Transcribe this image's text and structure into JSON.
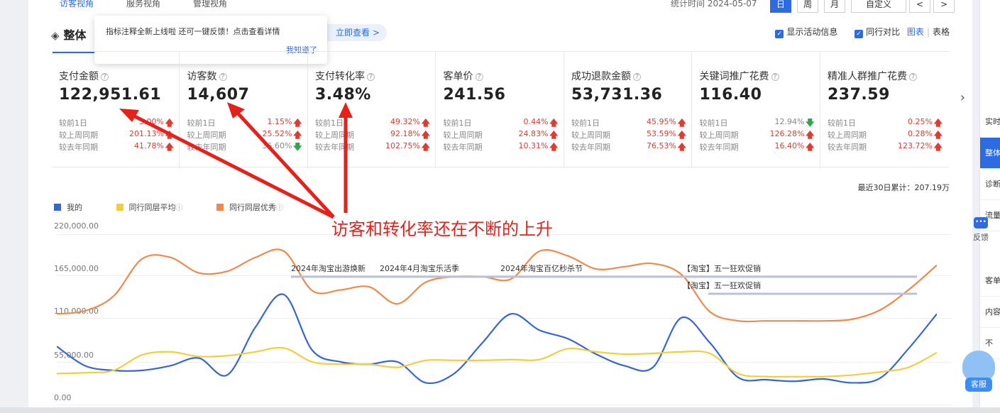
{
  "top_nav": {
    "tabs": [
      "访客视角",
      "服务视角",
      "管理视角"
    ],
    "stat_time": "统计时间 2024-05-07",
    "periods": [
      "日",
      "周",
      "月",
      "自定义"
    ],
    "prev_label": "<",
    "next_label": ">"
  },
  "section": {
    "title": "整体",
    "banner_link": "立即查看 >",
    "popup_text": "指标注释全新上线啦 还可一键反馈！点击查看详情",
    "popup_ok": "我知道了",
    "opt_activity": "显示活动信息",
    "opt_peer": "同行对比",
    "view_chart": "图表",
    "view_sep": "|",
    "view_table": "表格"
  },
  "compare_labels": [
    "较前1日",
    "较上周同期",
    "较去年同期"
  ],
  "metrics": [
    {
      "label": "支付金额",
      "value": "122,951.61",
      "changes": [
        {
          "pct": "5.00%",
          "dir": "up"
        },
        {
          "pct": "201.13%",
          "dir": "up"
        },
        {
          "pct": "41.78%",
          "dir": "up"
        }
      ]
    },
    {
      "label": "访客数",
      "value": "14,607",
      "changes": [
        {
          "pct": "1.15%",
          "dir": "up"
        },
        {
          "pct": "25.52%",
          "dir": "up"
        },
        {
          "pct": "36.60%",
          "dir": "down"
        }
      ]
    },
    {
      "label": "支付转化率",
      "value": "3.48%",
      "changes": [
        {
          "pct": "49.32%",
          "dir": "up"
        },
        {
          "pct": "92.18%",
          "dir": "up"
        },
        {
          "pct": "102.75%",
          "dir": "up"
        }
      ]
    },
    {
      "label": "客单价",
      "value": "241.56",
      "changes": [
        {
          "pct": "0.44%",
          "dir": "up"
        },
        {
          "pct": "24.83%",
          "dir": "up"
        },
        {
          "pct": "10.31%",
          "dir": "up"
        }
      ]
    },
    {
      "label": "成功退款金额",
      "value": "53,731.36",
      "changes": [
        {
          "pct": "45.95%",
          "dir": "up"
        },
        {
          "pct": "53.59%",
          "dir": "up"
        },
        {
          "pct": "76.53%",
          "dir": "up"
        }
      ]
    },
    {
      "label": "关键词推广花费",
      "value": "116.40",
      "changes": [
        {
          "pct": "12.94%",
          "dir": "down"
        },
        {
          "pct": "126.28%",
          "dir": "up"
        },
        {
          "pct": "16.40%",
          "dir": "up"
        }
      ]
    },
    {
      "label": "精准人群推广花费",
      "value": "237.59",
      "changes": [
        {
          "pct": "0.25%",
          "dir": "up"
        },
        {
          "pct": "0.28%",
          "dir": "up"
        },
        {
          "pct": "123.72%",
          "dir": "up"
        }
      ]
    }
  ],
  "recent_total": "最近30日累计：207.19万",
  "annotation": "访客和转化率还在不断的上升",
  "side_items": [
    "实时",
    "整体",
    "诊断",
    "流量",
    "客单",
    "内容",
    "不"
  ],
  "feedback_label": "反馈",
  "kefu_label": "客服",
  "colors": {
    "mine": "#3467d6",
    "peer_avg": "#f2cd3f",
    "peer_best": "#f0894a",
    "accent": "#2e6ae0",
    "arrow": "#e8201a"
  },
  "chart_data": {
    "type": "line",
    "ylim": [
      0,
      220000
    ],
    "yticks": [
      "220,000.00",
      "165,000.00",
      "110,000.00",
      "55,000.00",
      "0.00"
    ],
    "x": [
      1,
      2,
      3,
      4,
      5,
      6,
      7,
      8,
      9,
      10,
      11,
      12,
      13,
      14,
      15,
      16,
      17,
      18,
      19,
      20,
      21,
      22,
      23,
      24,
      25,
      26,
      27,
      28,
      29,
      30
    ],
    "series": [
      {
        "name": "我的",
        "key": "mine",
        "values": [
          75000,
          50000,
          44000,
          44000,
          50000,
          60000,
          38000,
          100000,
          142000,
          70000,
          55000,
          52000,
          55000,
          28000,
          40000,
          80000,
          117000,
          96000,
          85000,
          65000,
          50000,
          48000,
          112000,
          80000,
          35000,
          32000,
          30000,
          33000,
          28000,
          34000,
          72000,
          117000
        ]
      },
      {
        "name": "同行同层平均",
        "key": "peer_avg",
        "values": [
          40000,
          41000,
          44000,
          64000,
          68000,
          62000,
          63000,
          68000,
          73000,
          55000,
          52000,
          52000,
          48000,
          57000,
          57000,
          57000,
          58000,
          58000,
          72000,
          68000,
          65000,
          66000,
          68000,
          66000,
          40000,
          36000,
          36000,
          36000,
          38000,
          42000,
          48000,
          67000
        ]
      },
      {
        "name": "同行同层优秀",
        "key": "peer_best",
        "values": [
          117000,
          121000,
          140000,
          188000,
          190000,
          170000,
          172000,
          190000,
          198000,
          147000,
          148000,
          152000,
          130000,
          158000,
          165000,
          165000,
          162000,
          198000,
          192000,
          175000,
          178000,
          182000,
          168000,
          120000,
          108000,
          108000,
          108000,
          108000,
          110000,
          122000,
          148000,
          180000
        ]
      }
    ],
    "events": [
      {
        "label": "2024年淘宝出游焕新",
        "row": 0
      },
      {
        "label": "2024年4月淘宝乐活季",
        "row": 0
      },
      {
        "label": "2024年淘宝百亿秒杀节",
        "row": 0
      },
      {
        "label": "【淘宝】五一狂欢促销",
        "row": 0
      },
      {
        "label": "【淘宝】五一狂欢促销",
        "row": 1
      }
    ]
  }
}
